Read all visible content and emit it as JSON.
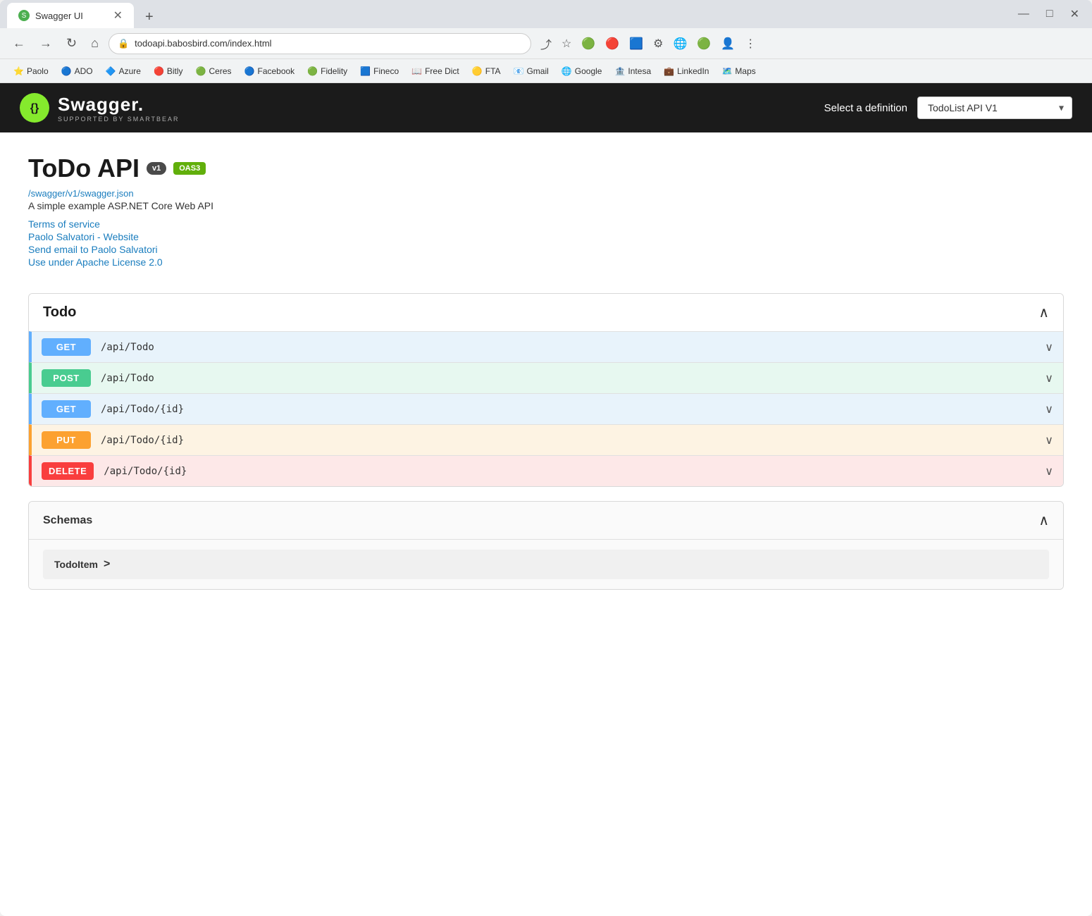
{
  "browser": {
    "tab_title": "Swagger UI",
    "tab_favicon": "S",
    "url": "todoapi.babosbird.com/index.html",
    "new_tab_icon": "+",
    "window_controls": [
      "—",
      "□",
      "✕"
    ]
  },
  "nav": {
    "back": "←",
    "forward": "→",
    "refresh": "↻",
    "home": "⌂",
    "lock_icon": "🔒",
    "url": "todoapi.babosbird.com/index.html"
  },
  "bookmarks": [
    {
      "label": "Paolo",
      "icon": "⭐"
    },
    {
      "label": "ADO",
      "icon": "🔵"
    },
    {
      "label": "Azure",
      "icon": "🔷"
    },
    {
      "label": "Bitly",
      "icon": "🔴"
    },
    {
      "label": "Ceres",
      "icon": "🟢"
    },
    {
      "label": "Facebook",
      "icon": "🔵"
    },
    {
      "label": "Fidelity",
      "icon": "🟢"
    },
    {
      "label": "Fineco",
      "icon": "🟦"
    },
    {
      "label": "Free Dict",
      "icon": "📖"
    },
    {
      "label": "FTA",
      "icon": "🟡"
    },
    {
      "label": "Gmail",
      "icon": "📧"
    },
    {
      "label": "Google",
      "icon": "🌐"
    },
    {
      "label": "Intesa",
      "icon": "🏦"
    },
    {
      "label": "LinkedIn",
      "icon": "💼"
    },
    {
      "label": "Maps",
      "icon": "🗺️"
    }
  ],
  "swagger": {
    "logo_letter": "S",
    "logo_text": "Swagger.",
    "logo_sub": "SUPPORTED BY SMARTBEAR",
    "select_label": "Select a definition",
    "select_value": "TodoList API V1",
    "select_options": [
      "TodoList API V1"
    ]
  },
  "api": {
    "title": "ToDo API",
    "badge_v1": "v1",
    "badge_oas3": "OAS3",
    "spec_url": "/swagger/v1/swagger.json",
    "description": "A simple example ASP.NET Core Web API",
    "links": [
      {
        "label": "Terms of service",
        "href": "#"
      },
      {
        "label": "Paolo Salvatori - Website",
        "href": "#"
      },
      {
        "label": "Send email to Paolo Salvatori",
        "href": "#"
      },
      {
        "label": "Use under Apache License 2.0",
        "href": "#"
      }
    ]
  },
  "todo_section": {
    "title": "Todo",
    "chevron": "∧",
    "endpoints": [
      {
        "method": "GET",
        "path": "/api/Todo",
        "type": "get"
      },
      {
        "method": "POST",
        "path": "/api/Todo",
        "type": "post"
      },
      {
        "method": "GET",
        "path": "/api/Todo/{id}",
        "type": "get"
      },
      {
        "method": "PUT",
        "path": "/api/Todo/{id}",
        "type": "put"
      },
      {
        "method": "DELETE",
        "path": "/api/Todo/{id}",
        "type": "delete"
      }
    ]
  },
  "schemas_section": {
    "title": "Schemas",
    "chevron": "∧",
    "items": [
      {
        "name": "TodoItem",
        "arrow": ">"
      }
    ]
  }
}
